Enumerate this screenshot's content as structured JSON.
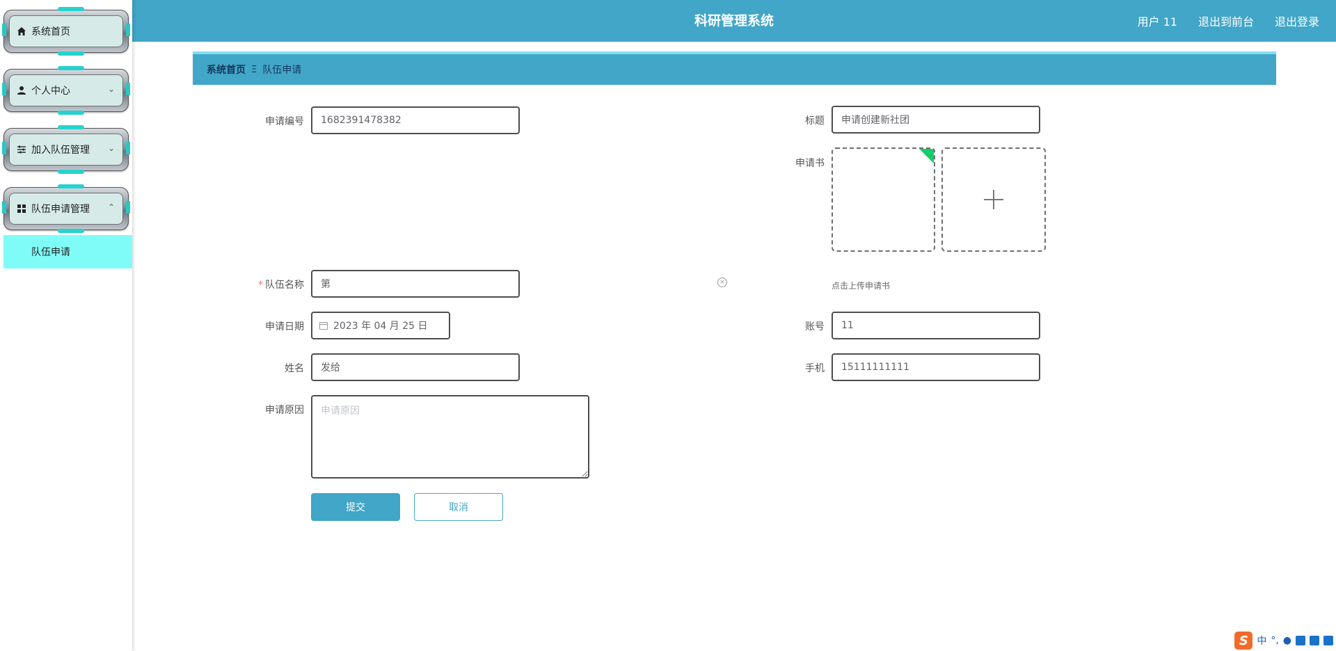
{
  "header": {
    "title": "科研管理系统",
    "user": "用户 11",
    "back_to_front": "退出到前台",
    "logout": "退出登录"
  },
  "sidebar": {
    "items": [
      {
        "label": "系统首页",
        "icon": "home-icon"
      },
      {
        "label": "个人中心",
        "icon": "user-icon"
      },
      {
        "label": "加入队伍管理",
        "icon": "sliders-icon"
      },
      {
        "label": "队伍申请管理",
        "icon": "grid-icon"
      }
    ],
    "submenu_active": "队伍申请"
  },
  "breadcrumb": {
    "home": "系统首页",
    "separator": "Ξ",
    "current": "队伍申请"
  },
  "form": {
    "apply_no": {
      "label": "申请编号",
      "value": "1682391478382"
    },
    "title": {
      "label": "标题",
      "value": "申请创建新社团"
    },
    "application_doc": {
      "label": "申请书",
      "hint": "点击上传申请书"
    },
    "team_name": {
      "label": "队伍名称",
      "required": "*",
      "value": "第"
    },
    "apply_date": {
      "label": "申请日期",
      "value": "2023 年 04 月 25 日"
    },
    "account": {
      "label": "账号",
      "value": "11"
    },
    "name": {
      "label": "姓名",
      "value": "发给"
    },
    "phone": {
      "label": "手机",
      "value": "15111111111"
    },
    "reason": {
      "label": "申请原因",
      "placeholder": "申请原因"
    },
    "submit": "提交",
    "cancel": "取消"
  },
  "ime": {
    "lang": "中",
    "punct": "°,"
  },
  "colors": {
    "primary": "#41a6c8",
    "submenu": "#7ffcf8",
    "badge": "#13ce66"
  }
}
